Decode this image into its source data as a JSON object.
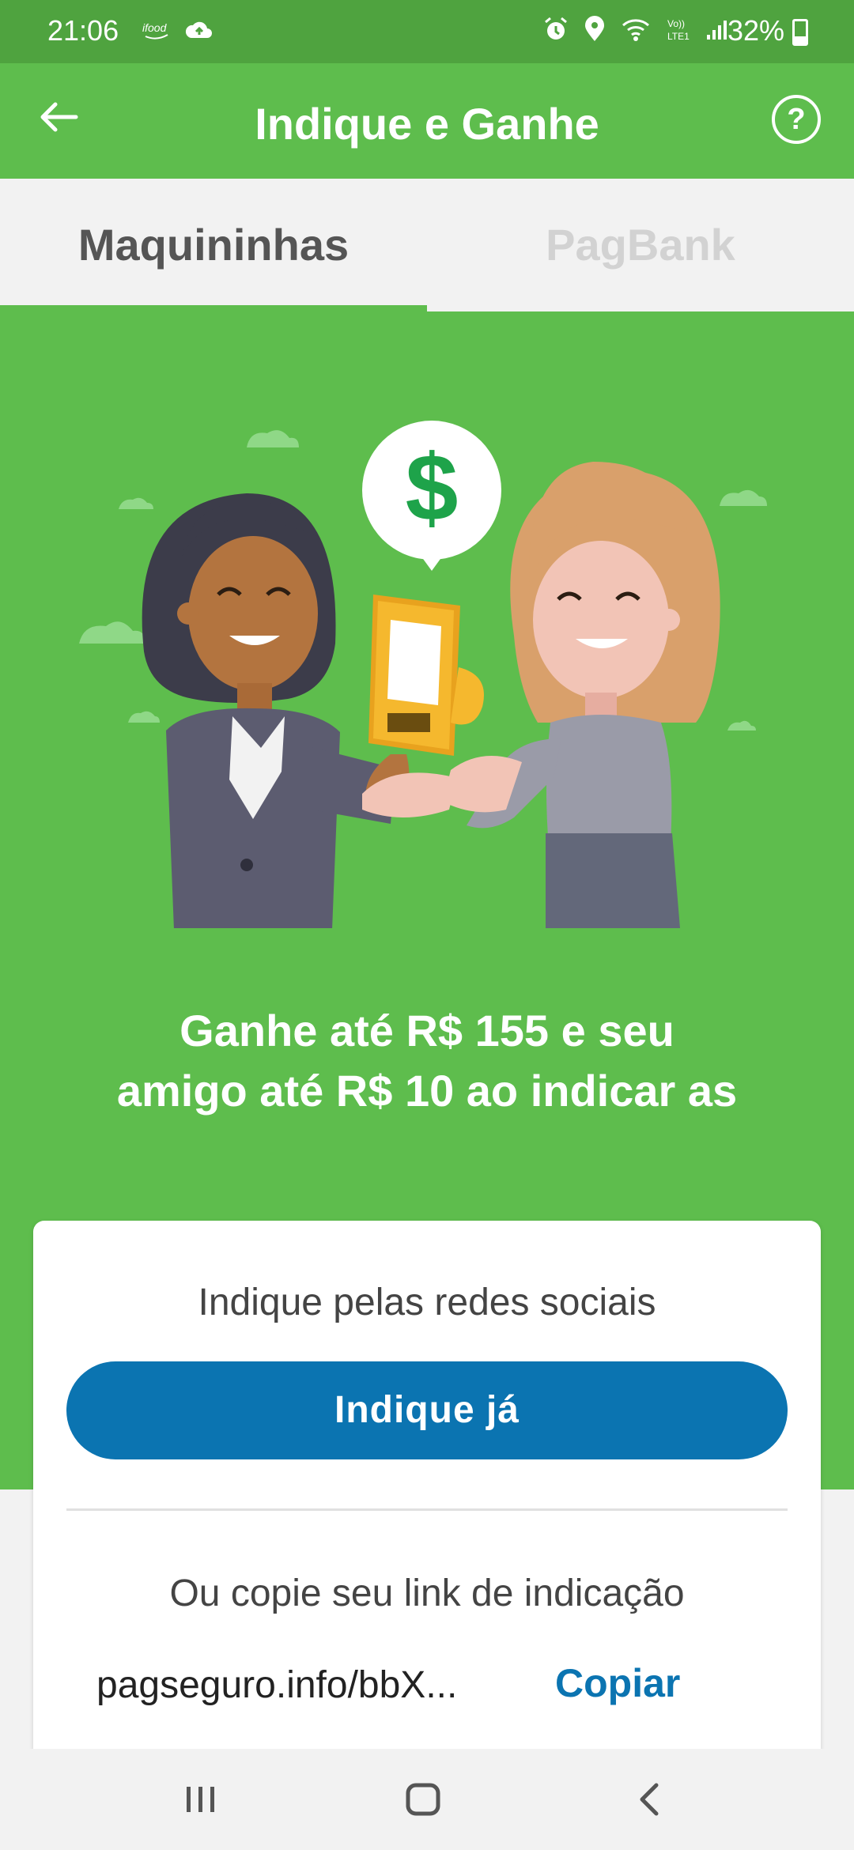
{
  "status_bar": {
    "time": "21:06",
    "battery_percent": "32%",
    "left_icons": [
      "ifood-icon",
      "cloud-upload-icon"
    ],
    "right_icons": [
      "alarm-icon",
      "location-icon",
      "wifi-icon",
      "volte-signal-icon"
    ]
  },
  "app_bar": {
    "title": "Indique e Ganhe",
    "help_label": "?"
  },
  "tabs": [
    {
      "label": "Maquininhas",
      "active": true
    },
    {
      "label": "PagBank",
      "active": false
    }
  ],
  "hero": {
    "headline_line1": "Ganhe até R$ 155 e seu",
    "headline_line2": "amigo até R$ 10 ao indicar as",
    "currency_symbol": "$"
  },
  "card": {
    "social_label": "Indique pelas redes sociais",
    "cta_label": "Indique já",
    "copy_label": "Ou copie seu link de indicação",
    "link_text": "pagseguro.info/bbX...",
    "copy_button": "Copiar"
  },
  "colors": {
    "brand_green": "#5ebd4d",
    "status_green": "#4fa33f",
    "primary_blue": "#0b74b1",
    "pos_yellow": "#f5b82e"
  }
}
